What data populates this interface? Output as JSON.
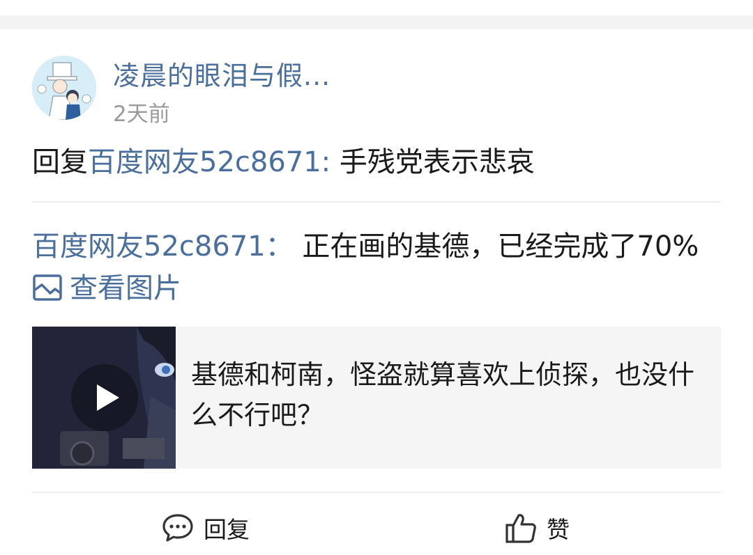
{
  "post": {
    "author_name": "凌晨的眼泪与假...",
    "time": "2天前",
    "reply_prefix": "回复",
    "reply_target": "百度网友52c8671:",
    "reply_text": " 手残党表示悲哀"
  },
  "quote": {
    "author": "百度网友52c8671：",
    "text": " 正在画的基德，已经完成了70%",
    "view_image_label": "查看图片"
  },
  "card": {
    "title": "基德和柯南，怪盗就算喜欢上侦探，也没什么不行吧？"
  },
  "actions": {
    "reply_label": "回复",
    "like_label": "赞"
  },
  "colors": {
    "link": "#4a6f9d",
    "muted": "#9a9a9a",
    "divider": "#eeeeee",
    "card_bg": "#f5f5f5"
  },
  "icons": {
    "view_image": "image-icon",
    "play": "play-icon",
    "reply": "comment-bubble-icon",
    "like": "thumbs-up-icon"
  }
}
